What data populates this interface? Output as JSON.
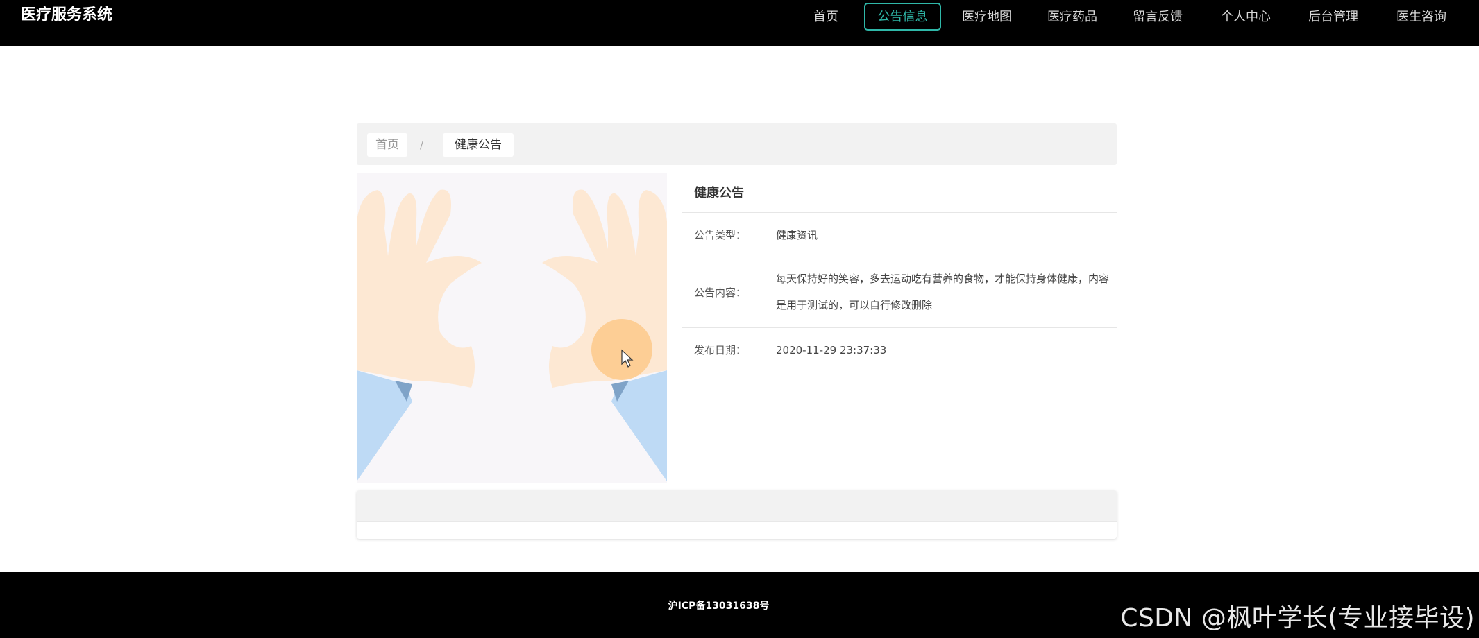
{
  "header": {
    "brand": "医疗服务系统",
    "nav": [
      {
        "label": "首页"
      },
      {
        "label": "公告信息",
        "active": true
      },
      {
        "label": "医疗地图"
      },
      {
        "label": "医疗药品"
      },
      {
        "label": "留言反馈"
      },
      {
        "label": "个人中心"
      },
      {
        "label": "后台管理"
      },
      {
        "label": "医生咨询"
      }
    ]
  },
  "breadcrumb": {
    "home": "首页",
    "separator": "/",
    "current": "健康公告"
  },
  "notice": {
    "title": "健康公告",
    "type_label": "公告类型：",
    "type_value": "健康资讯",
    "content_label": "公告内容：",
    "content_value": "每天保持好的笑容，多去运动吃有营养的食物，才能保持身体健康，内容是用于测试的，可以自行修改删除",
    "date_label": "发布日期：",
    "date_value": "2020-11-29 23:37:33"
  },
  "footer": {
    "icp": "沪ICP备13031638号"
  },
  "watermark": "CSDN @枫叶学长(专业接毕设)",
  "colors": {
    "accent": "#2fb7a8",
    "header_bg": "#000000",
    "panel_bg": "#f2f2f2"
  }
}
